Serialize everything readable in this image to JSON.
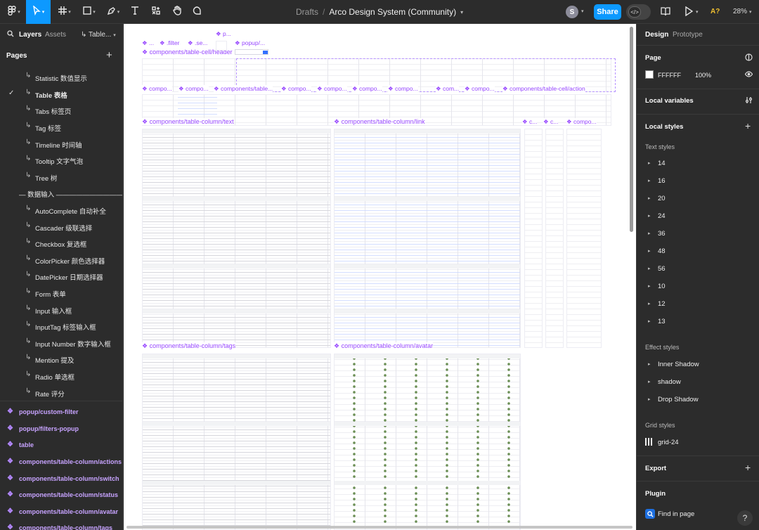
{
  "toolbar": {
    "breadcrumb_root": "Drafts",
    "breadcrumb_sep": "/",
    "file_name": "Arco Design System (Community)",
    "avatar_initial": "S",
    "share_label": "Share",
    "accessibility_badge": "A?",
    "zoom_level": "28%"
  },
  "left_panel": {
    "tab_layers": "Layers",
    "tab_assets": "Assets",
    "page_selector": "Table...",
    "pages_header": "Pages",
    "pages": [
      {
        "label": "Statistic 数值显示",
        "selected": false
      },
      {
        "label": "Table 表格",
        "selected": true
      },
      {
        "label": "Tabs 标签页",
        "selected": false
      },
      {
        "label": "Tag 标签",
        "selected": false
      },
      {
        "label": "Timeline 时间轴",
        "selected": false
      },
      {
        "label": "Tooltip 文字气泡",
        "selected": false
      },
      {
        "label": "Tree 树",
        "selected": false
      },
      {
        "label": "— 数据输入 ——————————...",
        "selected": false,
        "divider": true
      },
      {
        "label": "AutoComplete 自动补全",
        "selected": false
      },
      {
        "label": "Cascader 级联选择",
        "selected": false
      },
      {
        "label": "Checkbox 复选框",
        "selected": false
      },
      {
        "label": "ColorPicker 颜色选择器",
        "selected": false
      },
      {
        "label": "DatePicker 日期选择器",
        "selected": false
      },
      {
        "label": "Form 表单",
        "selected": false
      },
      {
        "label": "Input 输入框",
        "selected": false
      },
      {
        "label": "InputTag 标签输入框",
        "selected": false
      },
      {
        "label": "Input Number 数字输入框",
        "selected": false
      },
      {
        "label": "Mention 提及",
        "selected": false
      },
      {
        "label": "Radio 单选框",
        "selected": false
      },
      {
        "label": "Rate 评分",
        "selected": false
      }
    ],
    "layers": [
      "popup/custom-filter",
      "popup/filters-popup",
      "table",
      "components/table-column/actions",
      "components/table-column/switch",
      "components/table-column/status",
      "components/table-column/avatar",
      "components/table-column/tags"
    ]
  },
  "canvas": {
    "frame_labels": [
      "...",
      ".filter",
      ".se...",
      "p...",
      "popup/...",
      "components/table-cell/header",
      "compo...",
      "compo...",
      "components/table...",
      "compo...",
      "compo...",
      "compo...",
      "compo...",
      "com...",
      "compo...",
      "components/table-cell/action",
      "components/table-column/text",
      "components/table-column/link",
      "c...",
      "c...",
      "compo...",
      "components/table-column/tags",
      "components/table-column/avatar"
    ],
    "colors": {
      "frame_label": "#9747ff",
      "selection": "#0d99ff"
    }
  },
  "right_panel": {
    "tab_design": "Design",
    "tab_prototype": "Prototype",
    "page_header": "Page",
    "page_color": "FFFFFF",
    "page_opacity": "100%",
    "local_variables": "Local variables",
    "local_styles": "Local styles",
    "text_styles_header": "Text styles",
    "text_styles": [
      "14",
      "16",
      "20",
      "24",
      "36",
      "48",
      "56",
      "10",
      "12",
      "13"
    ],
    "effect_styles_header": "Effect styles",
    "effect_styles": [
      "Inner Shadow",
      "shadow",
      "Drop Shadow"
    ],
    "grid_styles_header": "Grid styles",
    "grid_style": "grid-24",
    "export_header": "Export",
    "plugin_header": "Plugin",
    "plugin_item": "Find in page",
    "help": "?"
  }
}
